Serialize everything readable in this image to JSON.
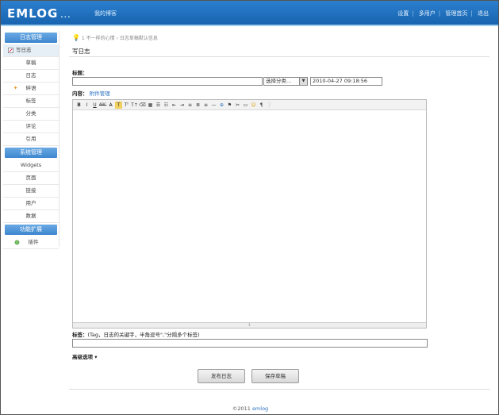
{
  "header": {
    "logo": "EMLOG",
    "logo_dots": "...",
    "blog_name": "我的博客",
    "nav": [
      "设置",
      "多用户",
      "管理首页",
      "退出"
    ]
  },
  "sidebar": {
    "sections": [
      {
        "title": "日志管理",
        "items": [
          "写日志",
          "草稿",
          "日志",
          "碎语",
          "标签",
          "分类",
          "评论",
          "引用"
        ]
      },
      {
        "title": "系统管理",
        "items": [
          "Widgets",
          "页面",
          "链接",
          "用户",
          "数据"
        ]
      },
      {
        "title": "功能扩展",
        "items": [
          "插件"
        ]
      }
    ],
    "active_item": "写日志"
  },
  "main": {
    "breadcrumb": "1 不一样的心情 › 日志草稿默认信息",
    "page_title": "写日志",
    "title_label": "标题：",
    "title_value": "",
    "category_value": "选择分类...",
    "date_value": "2010-04-27 09:18:56",
    "content_label": "内容：",
    "attachment_link": "附件管理",
    "toolbar": [
      "B",
      "I",
      "U",
      "ABC",
      "A̶",
      "T",
      "Tᶠ",
      "T↑",
      "⌫",
      "▦",
      "☰",
      "☷",
      "⇤",
      "⇥",
      "≡",
      "≣",
      "≡",
      "—",
      "⊕",
      "⚑",
      "✂",
      "▭",
      "☺",
      "¶",
      "❔"
    ],
    "tags_label": "标签：",
    "tags_hint": "(Tag，日志的关键字，半角逗号\",\"分隔多个标签)",
    "tags_value": "",
    "advanced_label": "高级选项 ▾",
    "publish_button": "发布日志",
    "save_button": "保存草稿"
  },
  "footer": {
    "copyright": "©2011",
    "brand": "emlog"
  }
}
